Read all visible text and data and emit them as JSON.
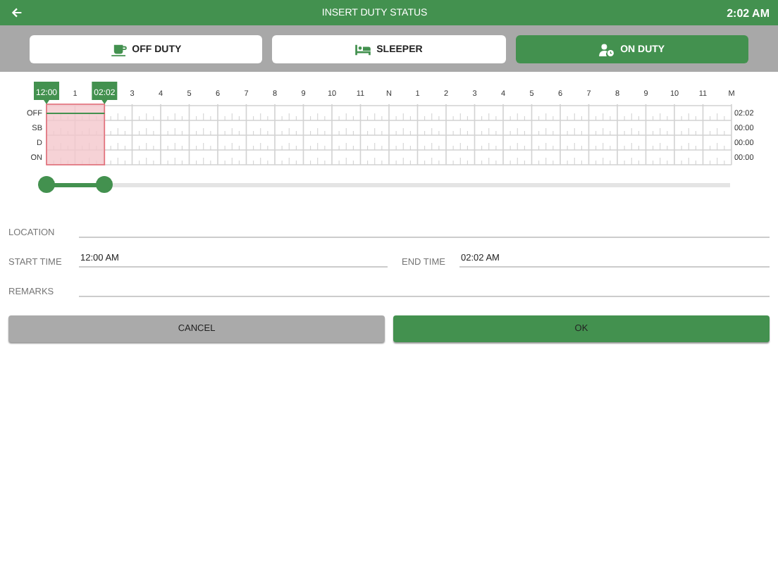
{
  "header": {
    "title": "INSERT DUTY STATUS",
    "time": "2:02 AM"
  },
  "tabs": [
    {
      "kind": "off",
      "label": "OFF DUTY",
      "selected": false
    },
    {
      "kind": "sleeper",
      "label": "SLEEPER",
      "selected": false
    },
    {
      "kind": "on",
      "label": "ON DUTY",
      "selected": true
    }
  ],
  "graph": {
    "start_flag": "12:00",
    "end_flag": "02:02",
    "hour_labels": [
      "1",
      "3",
      "4",
      "5",
      "6",
      "7",
      "8",
      "9",
      "10",
      "11",
      "N",
      "1",
      "2",
      "3",
      "4",
      "5",
      "6",
      "7",
      "8",
      "9",
      "10",
      "11",
      "M"
    ],
    "rows": [
      {
        "label": "OFF",
        "total": "02:02"
      },
      {
        "label": "SB",
        "total": "00:00"
      },
      {
        "label": "D",
        "total": "00:00"
      },
      {
        "label": "ON",
        "total": "00:00"
      }
    ]
  },
  "slider": {
    "start": {
      "level": 0
    },
    "end": {
      "level": 0.0847
    }
  },
  "form": {
    "location_label": "LOCATION",
    "start_label": "START TIME",
    "start_value": "12:00 AM",
    "end_label": "END TIME",
    "end_value": "02:02 AM",
    "remarks_label": "REMARKS"
  },
  "buttons": {
    "cancel": "CANCEL",
    "ok": "OK"
  }
}
